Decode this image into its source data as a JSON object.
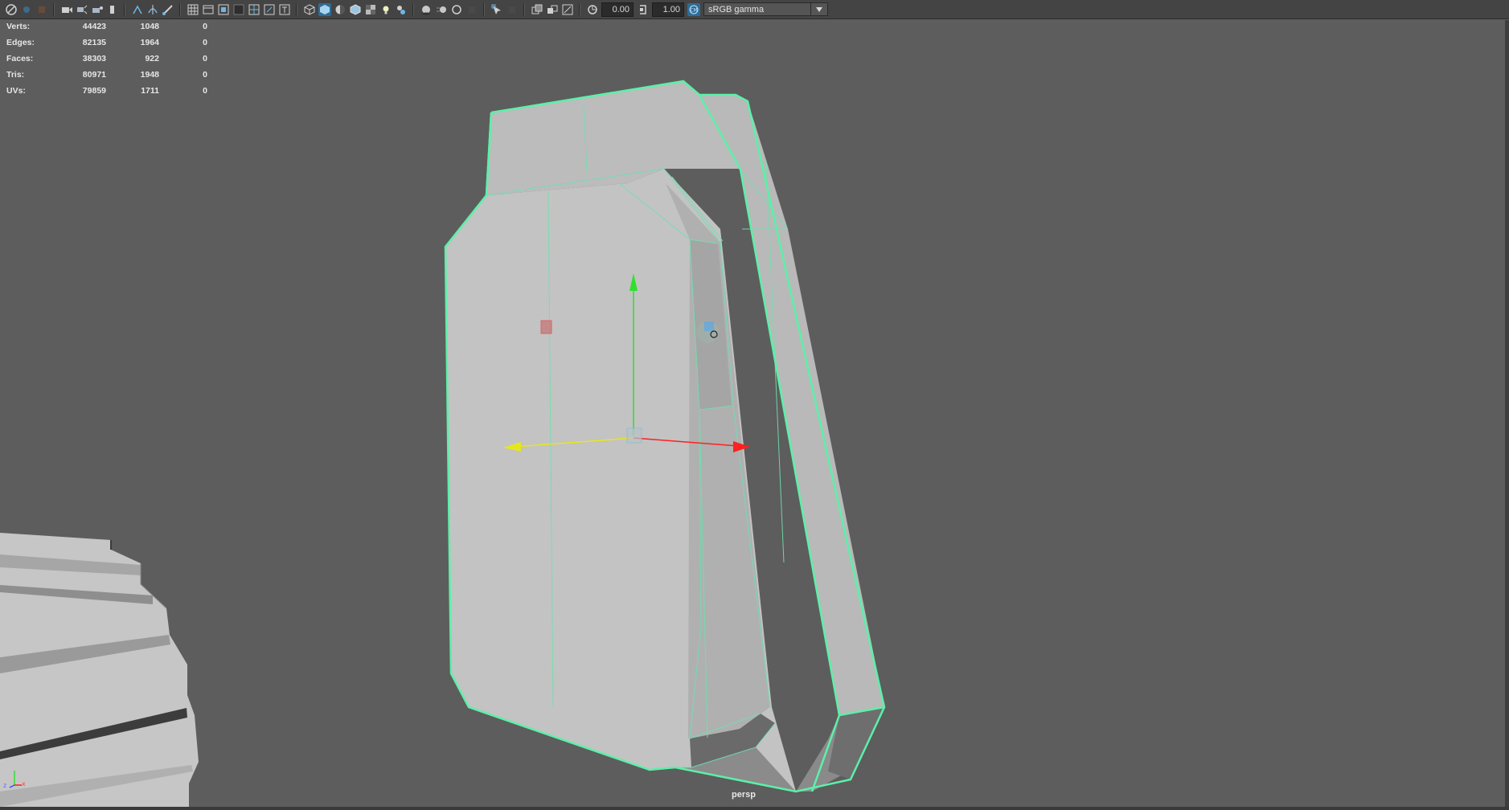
{
  "toolbar": {
    "icons_left": [
      "select-camera-icon",
      "camera-attributes-icon",
      "bookmark-icon",
      "image-plane-icon",
      "2d-pan-zoom-icon",
      "grease-pencil-icon",
      "camera-tumble-icon",
      "camera-track-icon",
      "camera-dolly-icon",
      "bookmark-flag-icon",
      "snap-icon",
      "snap-curve-icon",
      "snap-edit-icon"
    ],
    "icons_mid": [
      "grid-icon",
      "film-gate-icon",
      "resolution-gate-icon",
      "gate-mask-icon",
      "field-chart-icon",
      "safe-action-icon",
      "safe-title-icon",
      "wireframe-icon",
      "smooth-shade-icon",
      "use-default-material-icon",
      "wireframe-on-shaded-icon",
      "textured-icon",
      "lights-icon",
      "shadows-icon",
      "screen-space-ao-icon",
      "motion-blur-icon",
      "multisample-icon",
      "depth-of-field-icon",
      "isolate-select-icon",
      "xray-icon",
      "xray-active-icon",
      "xray-joints-icon",
      "xray-backface-icon"
    ],
    "exposure_value": "0.00",
    "gamma_value": "1.00",
    "color_management_label": "sRGB gamma"
  },
  "hud": {
    "rows": [
      {
        "label": "Verts:",
        "total": "44423",
        "selected": "1048",
        "component": "0"
      },
      {
        "label": "Edges:",
        "total": "82135",
        "selected": "1964",
        "component": "0"
      },
      {
        "label": "Faces:",
        "total": "38303",
        "selected": "922",
        "component": "0"
      },
      {
        "label": "Tris:",
        "total": "80971",
        "selected": "1948",
        "component": "0"
      },
      {
        "label": "UVs:",
        "total": "79859",
        "selected": "1711",
        "component": "0"
      }
    ]
  },
  "viewport": {
    "camera_name": "persp",
    "background_color": "#5d5d5d",
    "selection_color": "#5cf0a8",
    "axis_x_color": "#ff2020",
    "axis_y_color": "#30e030",
    "axis_z_color": "#e6e61e",
    "axis_indicator_labels": {
      "x": "x",
      "z": "z"
    }
  }
}
